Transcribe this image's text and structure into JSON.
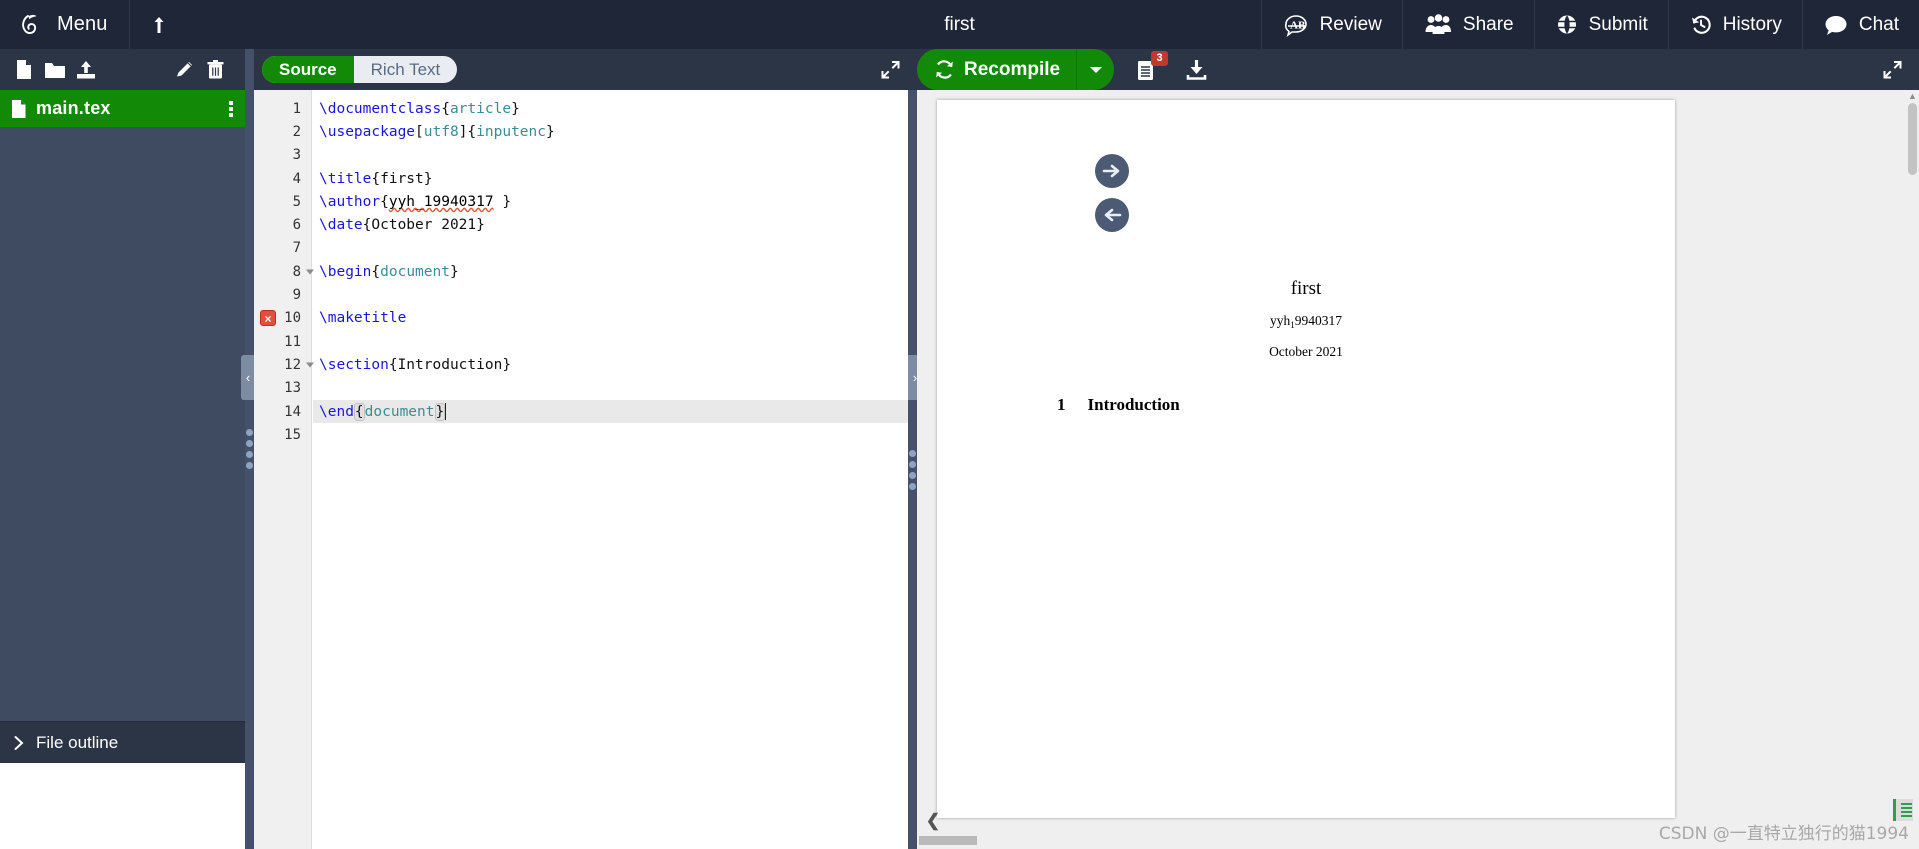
{
  "topbar": {
    "menu_label": "Menu",
    "project_title": "first",
    "upload_icon": "upload-arrow-icon",
    "items": [
      {
        "label": "Review",
        "icon": "review-ab-icon"
      },
      {
        "label": "Share",
        "icon": "share-people-icon"
      },
      {
        "label": "Submit",
        "icon": "submit-globe-icon"
      },
      {
        "label": "History",
        "icon": "history-clock-icon"
      },
      {
        "label": "Chat",
        "icon": "chat-bubble-icon"
      }
    ]
  },
  "filetools": {
    "new_file_icon": "new-file-icon",
    "new_folder_icon": "new-folder-icon",
    "upload_icon": "upload-file-icon",
    "rename_icon": "pencil-edit-icon",
    "delete_icon": "trash-delete-icon"
  },
  "editor_tabs": {
    "source_label": "Source",
    "richtext_label": "Rich Text",
    "active": "Source",
    "expand_icon": "expand-diagonal-icon"
  },
  "pdf_toolbar": {
    "recompile_label": "Recompile",
    "recompile_icon": "recompile-refresh-icon",
    "caret_icon": "chevron-down-icon",
    "logs_icon": "logs-document-icon",
    "logs_badge": "3",
    "download_icon": "download-pdf-icon",
    "expand_icon": "expand-diagonal-icon"
  },
  "sidebar": {
    "file": {
      "name": "main.tex",
      "icon": "tex-file-icon",
      "menu_icon": "kebab-menu-icon",
      "selected": true
    },
    "outline_label": "File outline",
    "outline_icon": "chevron-right-icon",
    "resize_handle": "sidebar-resize-handle"
  },
  "splitters": {
    "collapse_left_icon": "chevron-left-icon",
    "collapse_right_icon": "chevron-right-icon"
  },
  "sync": {
    "to_pdf_icon": "arrow-right-circle-icon",
    "to_code_icon": "arrow-left-circle-icon"
  },
  "code": {
    "active_line": 14,
    "error_line": 10,
    "error_marker": "×",
    "lines": [
      {
        "n": 1,
        "fold": false,
        "tokens": [
          {
            "t": "\\documentclass",
            "c": "cmd"
          },
          {
            "t": "{",
            "c": "brk"
          },
          {
            "t": "article",
            "c": "opt2"
          },
          {
            "t": "}",
            "c": "brk"
          }
        ]
      },
      {
        "n": 2,
        "fold": false,
        "tokens": [
          {
            "t": "\\usepackage",
            "c": "cmd"
          },
          {
            "t": "[",
            "c": "brk"
          },
          {
            "t": "utf8",
            "c": "opt2"
          },
          {
            "t": "]{",
            "c": "brk"
          },
          {
            "t": "inputenc",
            "c": "opt2"
          },
          {
            "t": "}",
            "c": "brk"
          }
        ]
      },
      {
        "n": 3,
        "fold": false,
        "tokens": []
      },
      {
        "n": 4,
        "fold": false,
        "tokens": [
          {
            "t": "\\title",
            "c": "cmd"
          },
          {
            "t": "{first}",
            "c": "plain"
          }
        ]
      },
      {
        "n": 5,
        "fold": false,
        "tokens": [
          {
            "t": "\\author",
            "c": "cmd"
          },
          {
            "t": "{",
            "c": "plain"
          },
          {
            "t": "yyh_19940317",
            "c": "spell"
          },
          {
            "t": " }",
            "c": "plain"
          }
        ]
      },
      {
        "n": 6,
        "fold": false,
        "tokens": [
          {
            "t": "\\date",
            "c": "cmd"
          },
          {
            "t": "{October 2021}",
            "c": "plain"
          }
        ]
      },
      {
        "n": 7,
        "fold": false,
        "tokens": []
      },
      {
        "n": 8,
        "fold": true,
        "tokens": [
          {
            "t": "\\begin",
            "c": "cmd"
          },
          {
            "t": "{",
            "c": "brk"
          },
          {
            "t": "document",
            "c": "opt2"
          },
          {
            "t": "}",
            "c": "brk"
          }
        ]
      },
      {
        "n": 9,
        "fold": false,
        "tokens": []
      },
      {
        "n": 10,
        "fold": false,
        "tokens": [
          {
            "t": "\\maketitle",
            "c": "cmd"
          }
        ]
      },
      {
        "n": 11,
        "fold": false,
        "tokens": []
      },
      {
        "n": 12,
        "fold": true,
        "tokens": [
          {
            "t": "\\section",
            "c": "cmd"
          },
          {
            "t": "{Introduction}",
            "c": "plain"
          }
        ]
      },
      {
        "n": 13,
        "fold": false,
        "tokens": []
      },
      {
        "n": 14,
        "fold": false,
        "tokens": [
          {
            "t": "\\end",
            "c": "cmd"
          },
          {
            "t": "{",
            "c": "brk-hl"
          },
          {
            "t": "document",
            "c": "opt2"
          },
          {
            "t": "}",
            "c": "brk-hl"
          }
        ]
      },
      {
        "n": 15,
        "fold": false,
        "tokens": []
      }
    ]
  },
  "pdf": {
    "title": "first",
    "author_prefix": "yyh",
    "author_sub": "1",
    "author_rest": "9940317",
    "date": "October 2021",
    "section_number": "1",
    "section_title": "Introduction",
    "back_icon": "chevron-left-icon",
    "scroll_up_icon": "caret-up-icon",
    "scroll_down_icon": "caret-down-icon"
  },
  "watermark": {
    "text": "CSDN @一直特立独行的猫1994"
  }
}
